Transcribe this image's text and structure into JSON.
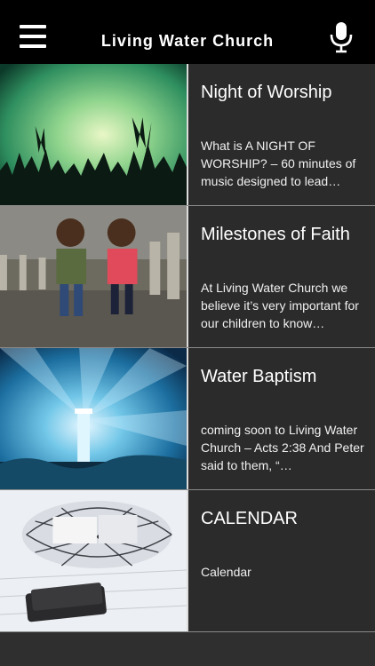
{
  "header": {
    "title": "Living Water Church",
    "menu_icon": "hamburger-menu-icon",
    "mic_icon": "microphone-icon"
  },
  "items": [
    {
      "title": "Night of Worship",
      "description": "What is A NIGHT OF WORSHIP? – 60 minutes of music designed to lead…",
      "image": "concert-crowd-hands-raised"
    },
    {
      "title": "Milestones of Faith",
      "description": "At Living Water Church we believe it’s very important for our children to know…",
      "image": "two-children-on-cobblestone-path"
    },
    {
      "title": "Water Baptism",
      "description": "coming soon to Living Water Church – Acts 2:38 And Peter said to them, “…",
      "image": "lighthouse-with-blue-light-rays"
    },
    {
      "title": "CALENDAR",
      "description": "Calendar",
      "image": "basket-with-newspapers-and-wallet"
    }
  ],
  "colors": {
    "header_bg": "#000000",
    "list_bg": "#2b2b2b",
    "divider": "#8a8a8a",
    "text": "#ffffff"
  }
}
